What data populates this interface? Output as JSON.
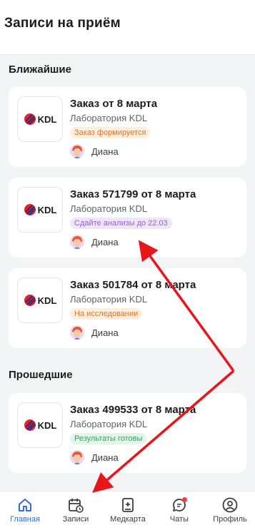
{
  "header": {
    "title": "Записи на приём"
  },
  "sections": {
    "upcoming": "Ближайшие",
    "past": "Прошедшие"
  },
  "orders": [
    {
      "title": "Заказ от 8 марта",
      "lab": "Лаборатория KDL",
      "status": "Заказ формируется",
      "status_color": "#e27323",
      "patient": "Диана",
      "logo": "KDL"
    },
    {
      "title": "Заказ 571799 от 8 марта",
      "lab": "Лаборатория KDL",
      "status": "Сдайте анализы до 22.03",
      "status_color": "#9a5ad8",
      "patient": "Диана",
      "logo": "KDL"
    },
    {
      "title": "Заказ 501784 от 8 марта",
      "lab": "Лаборатория KDL",
      "status": "На исследовании",
      "status_color": "#e27323",
      "patient": "Диана",
      "logo": "KDL"
    },
    {
      "title": "Заказ 499533 от 8 марта",
      "lab": "Лаборатория KDL",
      "status": "Результаты готовы",
      "status_color": "#3aa064",
      "patient": "Диана",
      "logo": "KDL"
    }
  ],
  "nav": {
    "items": [
      {
        "label": "Главная",
        "icon": "home-icon",
        "active": true
      },
      {
        "label": "Записи",
        "icon": "calendar-clock-icon"
      },
      {
        "label": "Медкарта",
        "icon": "medical-card-icon"
      },
      {
        "label": "Чаты",
        "icon": "chat-icon",
        "badge": true
      },
      {
        "label": "Профиль",
        "icon": "profile-icon"
      }
    ]
  },
  "colors": {
    "accent": "#2f6fde",
    "annotation": "#e8161b",
    "notification": "#ff3b30"
  }
}
